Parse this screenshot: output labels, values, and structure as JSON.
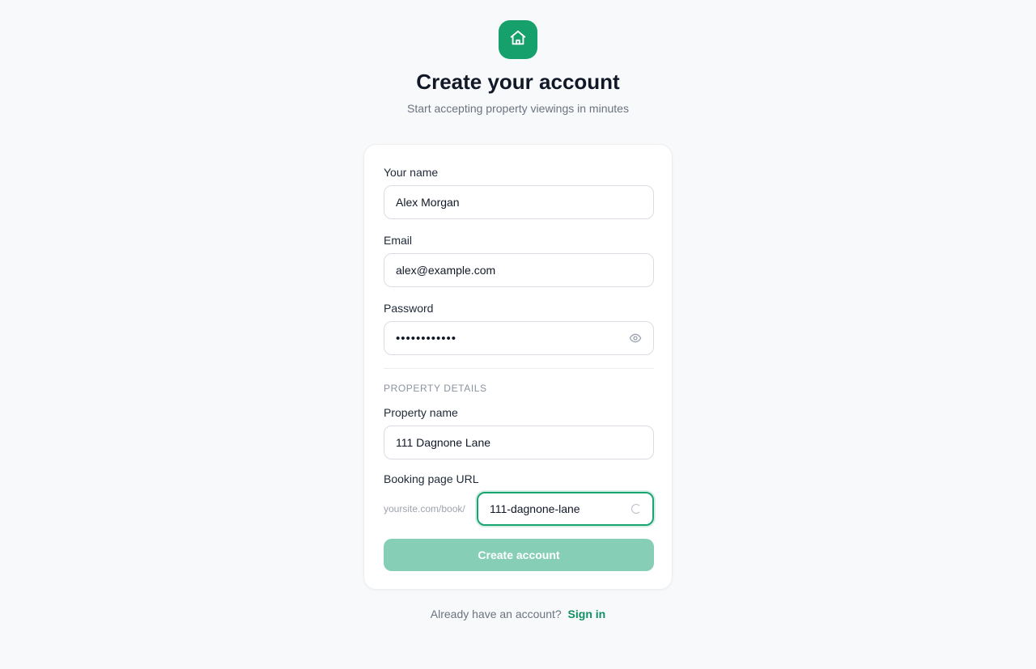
{
  "header": {
    "logo_icon": "home-icon",
    "brand_color": "#16a06b",
    "title": "Create your account",
    "subtitle": "Start accepting property viewings in minutes"
  },
  "form": {
    "name": {
      "label": "Your name",
      "value": "Alex Morgan"
    },
    "email": {
      "label": "Email",
      "value": "alex@example.com"
    },
    "password": {
      "label": "Password",
      "value": "••••••••••••",
      "toggle_icon": "eye-icon"
    },
    "property_section": {
      "title": "PROPERTY DETAILS"
    },
    "property_name": {
      "label": "Property name",
      "value": "111 Dagnone Lane"
    },
    "booking_url": {
      "label": "Booking page URL",
      "prefix": "yoursite.com/book/",
      "value": "111-dagnone-lane",
      "status_icon": "loading-spinner-icon"
    },
    "submit_label": "Create account",
    "submit_color": "#86cfb6"
  },
  "footer": {
    "prompt": "Already have an account?",
    "link": "Sign in",
    "link_color": "#119063"
  }
}
